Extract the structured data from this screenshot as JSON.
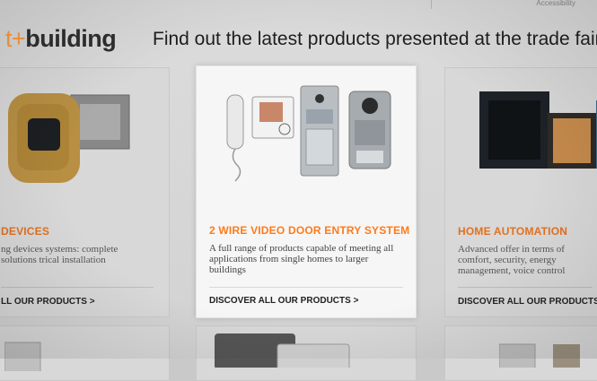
{
  "header": {
    "brand_prefix": "t+",
    "brand_word": "building",
    "tagline": "Find out the latest products presented at the trade fair",
    "top_link": "Accessibility"
  },
  "cards": [
    {
      "title": "DEVICES",
      "description": "ng devices systems: complete solutions trical installation",
      "link": "LL OUR PRODUCTS >"
    },
    {
      "title": "2 WIRE VIDEO DOOR ENTRY SYSTEM",
      "description": "A full range of products capable of meeting all applications from single homes to larger buildings",
      "link": "DISCOVER ALL OUR PRODUCTS >"
    },
    {
      "title": "HOME AUTOMATION",
      "description": "Advanced offer in terms of comfort, security, energy management, voice control",
      "link": "DISCOVER ALL OUR PRODUCTS >"
    }
  ],
  "colors": {
    "accent": "#ff7a1a",
    "background": "#d6d6d6",
    "active_card": "#f6f6f6"
  }
}
